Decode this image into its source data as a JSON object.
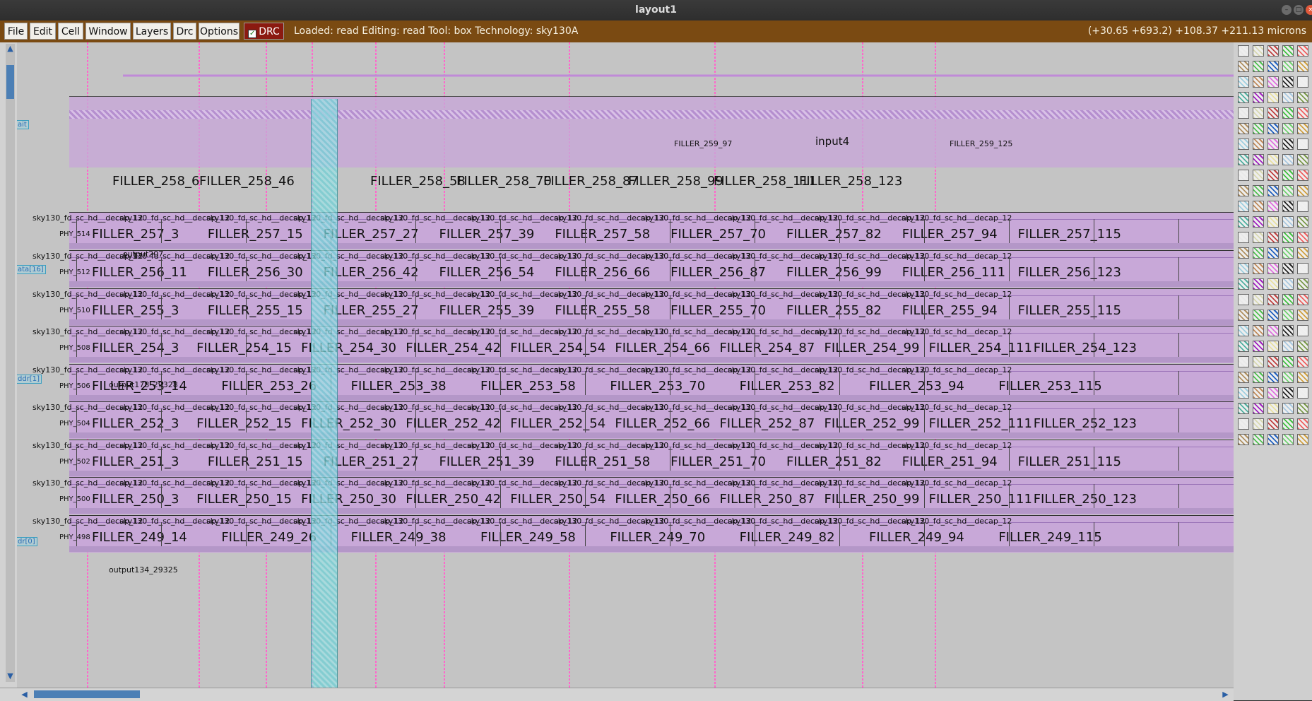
{
  "window": {
    "title": "layout1"
  },
  "menubar": {
    "items": [
      "File",
      "Edit",
      "Cell",
      "Window",
      "Layers",
      "Drc",
      "Options"
    ],
    "drc_label": "DRC",
    "status": "Loaded: read Editing: read Tool: box  Technology: sky130A",
    "coords": "(+30.65 +693.2) +108.37 +211.13 microns"
  },
  "pins": [
    "ait",
    "ata[16]",
    "ddr[1]",
    "dr[0]"
  ],
  "rows": [
    {
      "phy": "PHY_514",
      "fillers": [
        "FILLER_257_3",
        "FILLER_257_15",
        "FILLER_257_27",
        "FILLER_257_39",
        "FILLER_257_58",
        "FILLER_257_70",
        "FILLER_257_82",
        "FILLER_257_94",
        "FILLER_257_115"
      ]
    },
    {
      "phy": "PHY_512",
      "fillers": [
        "FILLER_256_11",
        "FILLER_256_30",
        "FILLER_256_42",
        "FILLER_256_54",
        "FILLER_256_66",
        "FILLER_256_87",
        "FILLER_256_99",
        "FILLER_256_111",
        "FILLER_256_123"
      ]
    },
    {
      "phy": "PHY_510",
      "fillers": [
        "FILLER_255_3",
        "FILLER_255_15",
        "FILLER_255_27",
        "FILLER_255_39",
        "FILLER_255_58",
        "FILLER_255_70",
        "FILLER_255_82",
        "FILLER_255_94",
        "FILLER_255_115"
      ]
    },
    {
      "phy": "PHY_508",
      "fillers": [
        "FILLER_254_3",
        "FILLER_254_15",
        "FILLER_254_30",
        "FILLER_254_42",
        "FILLER_254_54",
        "FILLER_254_66",
        "FILLER_254_87",
        "FILLER_254_99",
        "FILLER_254_111",
        "FILLER_254_123"
      ]
    },
    {
      "phy": "PHY_506",
      "fillers": [
        "FILLER_253_14",
        "FILLER_253_26",
        "FILLER_253_38",
        "FILLER_253_58",
        "FILLER_253_70",
        "FILLER_253_82",
        "FILLER_253_94",
        "FILLER_253_115"
      ]
    },
    {
      "phy": "PHY_504",
      "fillers": [
        "FILLER_252_3",
        "FILLER_252_15",
        "FILLER_252_30",
        "FILLER_252_42",
        "FILLER_252_54",
        "FILLER_252_66",
        "FILLER_252_87",
        "FILLER_252_99",
        "FILLER_252_111",
        "FILLER_252_123"
      ]
    },
    {
      "phy": "PHY_502",
      "fillers": [
        "FILLER_251_3",
        "FILLER_251_15",
        "FILLER_251_27",
        "FILLER_251_39",
        "FILLER_251_58",
        "FILLER_251_70",
        "FILLER_251_82",
        "FILLER_251_94",
        "FILLER_251_115"
      ]
    },
    {
      "phy": "PHY_500",
      "fillers": [
        "FILLER_250_3",
        "FILLER_250_15",
        "FILLER_250_30",
        "FILLER_250_42",
        "FILLER_250_54",
        "FILLER_250_66",
        "FILLER_250_87",
        "FILLER_250_99",
        "FILLER_250_111",
        "FILLER_250_123"
      ]
    },
    {
      "phy": "PHY_498",
      "fillers": [
        "FILLER_249_14",
        "FILLER_249_26",
        "FILLER_249_38",
        "FILLER_249_58",
        "FILLER_249_70",
        "FILLER_249_82",
        "FILLER_249_94",
        "FILLER_249_115"
      ]
    }
  ],
  "top_rows": [
    {
      "fillers": [
        "FILLER_258_6",
        "FILLER_258_46",
        "FILLER_258_58",
        "FILLER_258_70",
        "FILLER_258_87",
        "FILLER_258_99",
        "FILLER_258_111",
        "FILLER_258_123"
      ]
    }
  ],
  "decap_label": "sky130_fd_sc_hd__decap_12",
  "small_labels": [
    "input4",
    "output207",
    "output178_29328",
    "output134_29325",
    "FILLER_259_97",
    "FILLER_259_125"
  ],
  "colors": {
    "menubar": "#7a4a12",
    "canvas": "#c4c4c4",
    "cell_fill": "#c8a8d8",
    "wire": "#ff66cc",
    "highlight": "#6fd0d6"
  }
}
